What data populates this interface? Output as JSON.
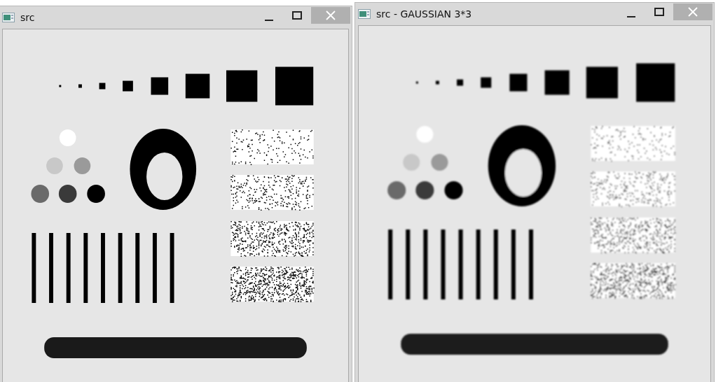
{
  "windows": [
    {
      "title": "src",
      "kind": "picture"
    },
    {
      "title": "src - GAUSSIAN 3*3",
      "kind": "picture"
    }
  ]
}
